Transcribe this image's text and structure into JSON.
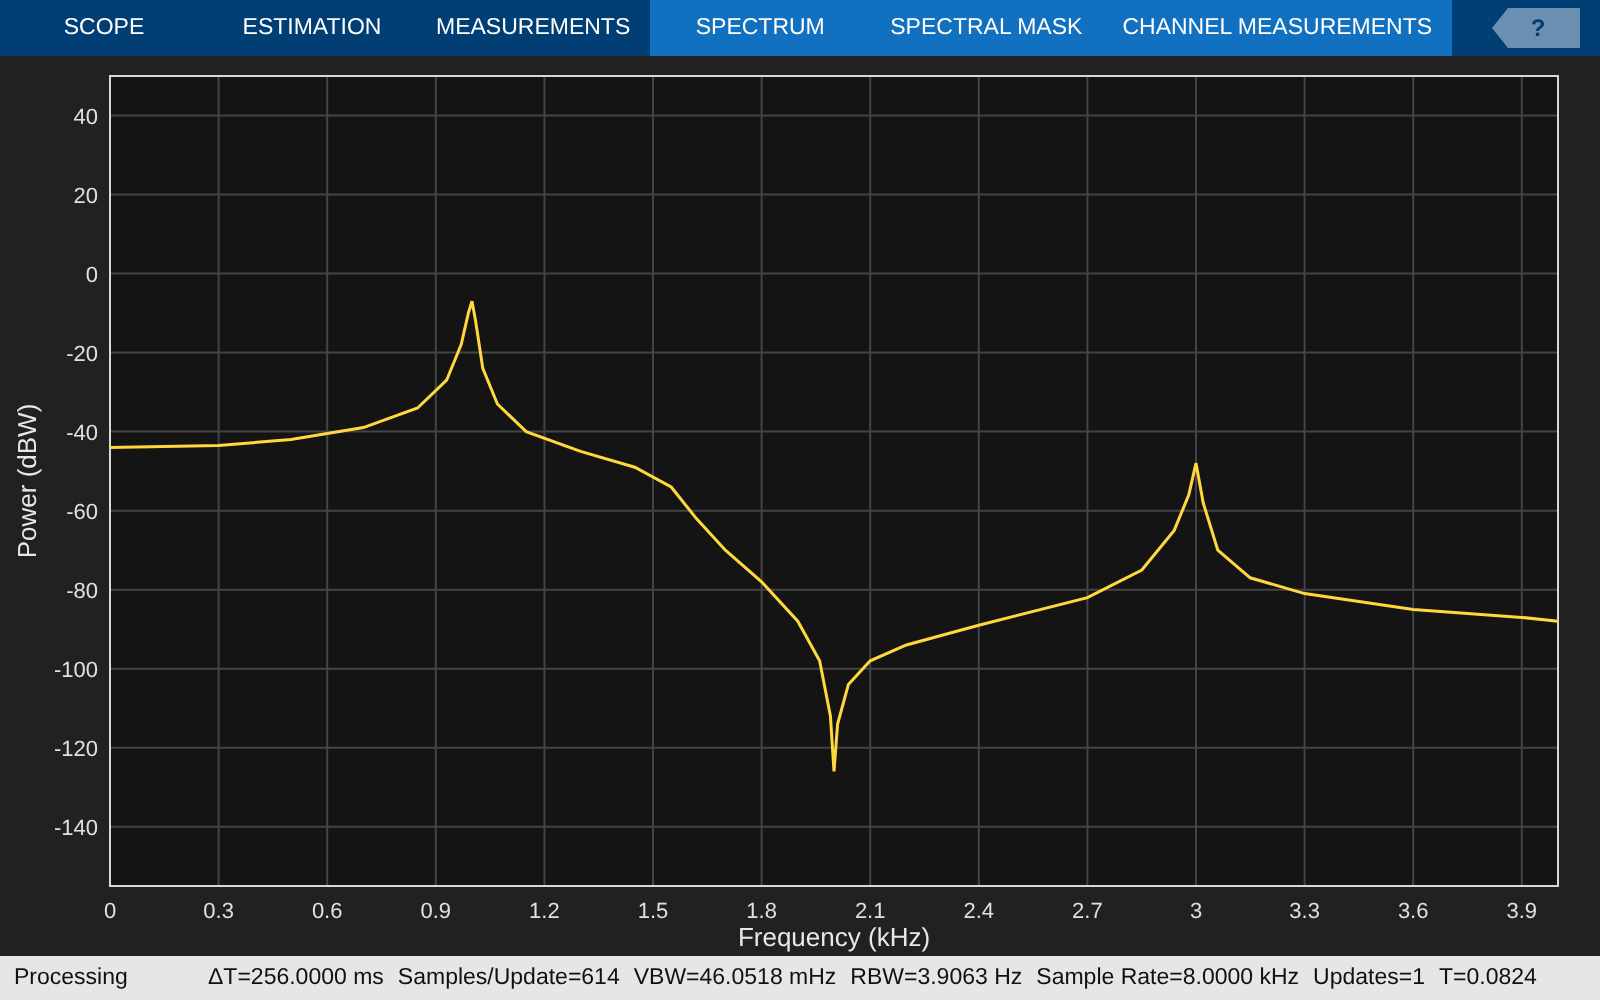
{
  "tabs": [
    {
      "label": "SCOPE",
      "kind": "global"
    },
    {
      "label": "ESTIMATION",
      "kind": "global"
    },
    {
      "label": "MEASUREMENTS",
      "kind": "global"
    },
    {
      "label": "SPECTRUM",
      "kind": "contextual"
    },
    {
      "label": "SPECTRAL MASK",
      "kind": "contextual"
    },
    {
      "label": "CHANNEL MEASUREMENTS",
      "kind": "contextual"
    }
  ],
  "help_button": {
    "label": "?"
  },
  "plot": {
    "chart_data": {
      "type": "line",
      "grid": true,
      "xlabel": "Frequency (kHz)",
      "ylabel": "Power (dBW)",
      "xlim": [
        0,
        4
      ],
      "ylim": [
        -155,
        50
      ],
      "xticks": [
        {
          "value": 0,
          "label": "0"
        },
        {
          "value": 0.3,
          "label": "0.3"
        },
        {
          "value": 0.6,
          "label": "0.6"
        },
        {
          "value": 0.9,
          "label": "0.9"
        },
        {
          "value": 1.2,
          "label": "1.2"
        },
        {
          "value": 1.5,
          "label": "1.5"
        },
        {
          "value": 1.8,
          "label": "1.8"
        },
        {
          "value": 2.1,
          "label": "2.1"
        },
        {
          "value": 2.4,
          "label": "2.4"
        },
        {
          "value": 2.7,
          "label": "2.7"
        },
        {
          "value": 3,
          "label": "3"
        },
        {
          "value": 3.3,
          "label": "3.3"
        },
        {
          "value": 3.6,
          "label": "3.6"
        },
        {
          "value": 3.9,
          "label": "3.9"
        }
      ],
      "yticks": [
        40,
        20,
        0,
        -20,
        -40,
        -60,
        -80,
        -100,
        -120,
        -140
      ],
      "x": [
        0,
        0.3,
        0.5,
        0.7,
        0.85,
        0.93,
        0.97,
        0.99,
        1.0,
        1.01,
        1.03,
        1.07,
        1.15,
        1.3,
        1.45,
        1.55,
        1.62,
        1.7,
        1.8,
        1.9,
        1.96,
        1.99,
        2.0,
        2.01,
        2.04,
        2.1,
        2.2,
        2.4,
        2.7,
        2.85,
        2.94,
        2.98,
        3.0,
        3.02,
        3.06,
        3.15,
        3.3,
        3.6,
        3.9,
        4.0
      ],
      "series": [
        {
          "color": "#ffd83d",
          "values": [
            -44,
            -43.5,
            -42,
            -39,
            -34,
            -27,
            -18,
            -10,
            -7,
            -12,
            -24,
            -33,
            -40,
            -45,
            -49,
            -54,
            -62,
            -70,
            -78,
            -88,
            -98,
            -112,
            -126,
            -114,
            -104,
            -98,
            -94,
            -89,
            -82,
            -75,
            -65,
            -56,
            -48,
            -58,
            -70,
            -77,
            -81,
            -85,
            -87,
            -88
          ]
        }
      ]
    }
  },
  "status_bar": {
    "state": "Processing",
    "fields": [
      "ΔT=256.0000 ms",
      "Samples/Update=614",
      "VBW=46.0518 mHz",
      "RBW=3.9063 Hz",
      "Sample Rate=8.0000 kHz",
      "Updates=1",
      "T=0.0824"
    ]
  }
}
